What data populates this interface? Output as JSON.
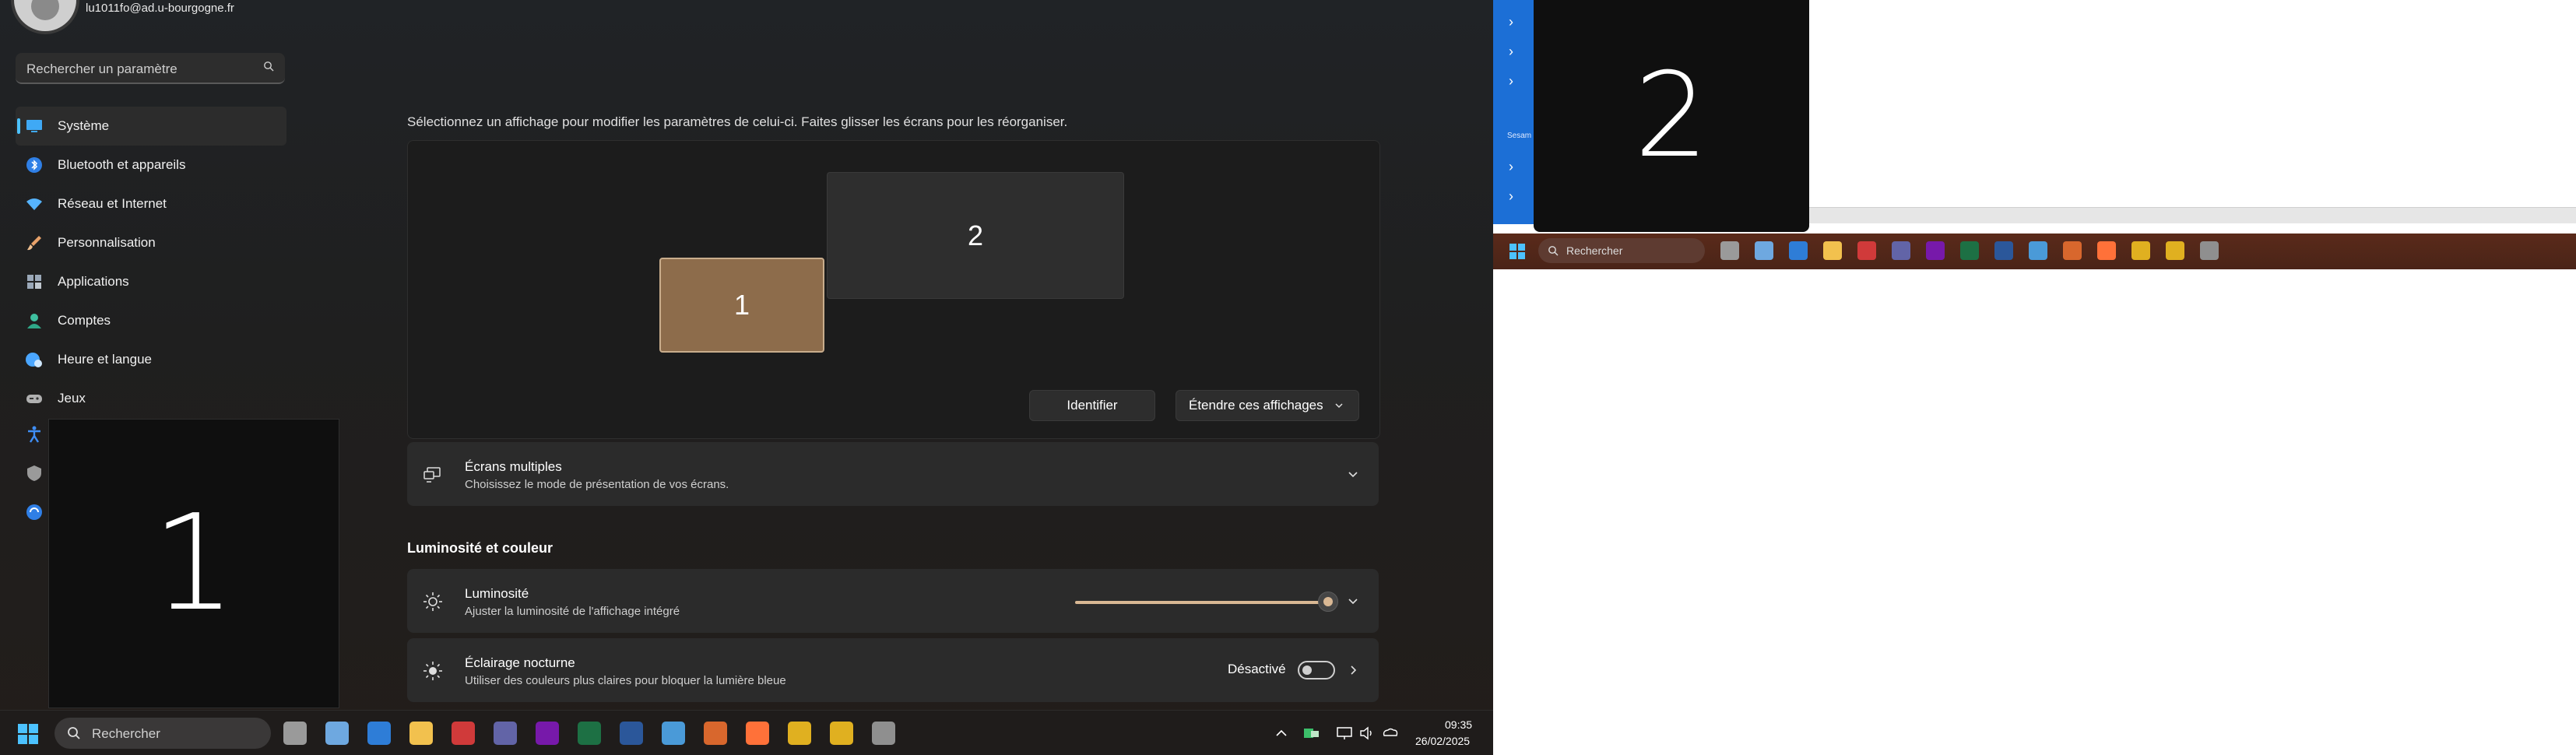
{
  "account": {
    "email": "lu1011fo@ad.u-bourgogne.fr"
  },
  "search": {
    "placeholder": "Rechercher un paramètre"
  },
  "nav": [
    {
      "label": "Système",
      "icon": "monitor-icon",
      "color": "#3fa9f5"
    },
    {
      "label": "Bluetooth et appareils",
      "icon": "bluetooth-icon",
      "color": "#3f8ef5"
    },
    {
      "label": "Réseau et Internet",
      "icon": "wifi-icon",
      "color": "#56b4ff"
    },
    {
      "label": "Personnalisation",
      "icon": "paintbrush-icon",
      "color": "#e8a26a"
    },
    {
      "label": "Applications",
      "icon": "apps-icon",
      "color": "#9aa8b8"
    },
    {
      "label": "Comptes",
      "icon": "accounts-icon",
      "color": "#3fc0a0"
    },
    {
      "label": "Heure et langue",
      "icon": "globe-clock-icon",
      "color": "#4aa6ff"
    },
    {
      "label": "Jeux",
      "icon": "gamepad-icon",
      "color": "#b0b0b0"
    }
  ],
  "display": {
    "hint": "Sélectionnez un affichage pour modifier les paramètres de celui-ci. Faites glisser les écrans pour les réorganiser.",
    "screen1": "1",
    "screen2": "2",
    "identify_label": "Identifier",
    "extend_label": "Étendre ces affichages"
  },
  "multi": {
    "title": "Écrans multiples",
    "subtitle": "Choisissez le mode de présentation de vos écrans."
  },
  "section_brightness": "Luminosité et couleur",
  "brightness": {
    "title": "Luminosité",
    "subtitle": "Ajuster la luminosité de l'affichage intégré",
    "level": 1.0
  },
  "night": {
    "title": "Éclairage nocturne",
    "subtitle": "Utiliser des couleurs plus claires pour bloquer la lumière bleue",
    "state": "Désactivé"
  },
  "identify_overlay": {
    "left": "1",
    "right": "2"
  },
  "taskbar": {
    "search_placeholder": "Rechercher",
    "time": "09:35",
    "date": "26/02/2025",
    "apps": [
      {
        "name": "task-view-icon",
        "color": "#9a9a9a"
      },
      {
        "name": "widgets-icon",
        "color": "#6ea8e0"
      },
      {
        "name": "outlook-icon",
        "color": "#2e7dd7"
      },
      {
        "name": "file-explorer-icon",
        "color": "#f2c14e"
      },
      {
        "name": "teams-chat-icon",
        "color": "#d03a3a"
      },
      {
        "name": "teams-icon",
        "color": "#6264a7"
      },
      {
        "name": "onenote-icon",
        "color": "#7719aa"
      },
      {
        "name": "excel-icon",
        "color": "#1d7044"
      },
      {
        "name": "word-icon",
        "color": "#2b579a"
      },
      {
        "name": "network-app-icon",
        "color": "#4a9ad8"
      },
      {
        "name": "game-app-icon",
        "color": "#d8672d"
      },
      {
        "name": "firefox-icon",
        "color": "#ff7139"
      },
      {
        "name": "chrome-icon",
        "color": "#e0b020"
      },
      {
        "name": "chrome-profile-icon",
        "color": "#e0b020"
      },
      {
        "name": "settings-gear-icon",
        "color": "#8f8f8f"
      }
    ]
  },
  "right_taskbar": {
    "search_placeholder": "Rechercher"
  },
  "right_panel": {
    "label": "Sesam"
  }
}
